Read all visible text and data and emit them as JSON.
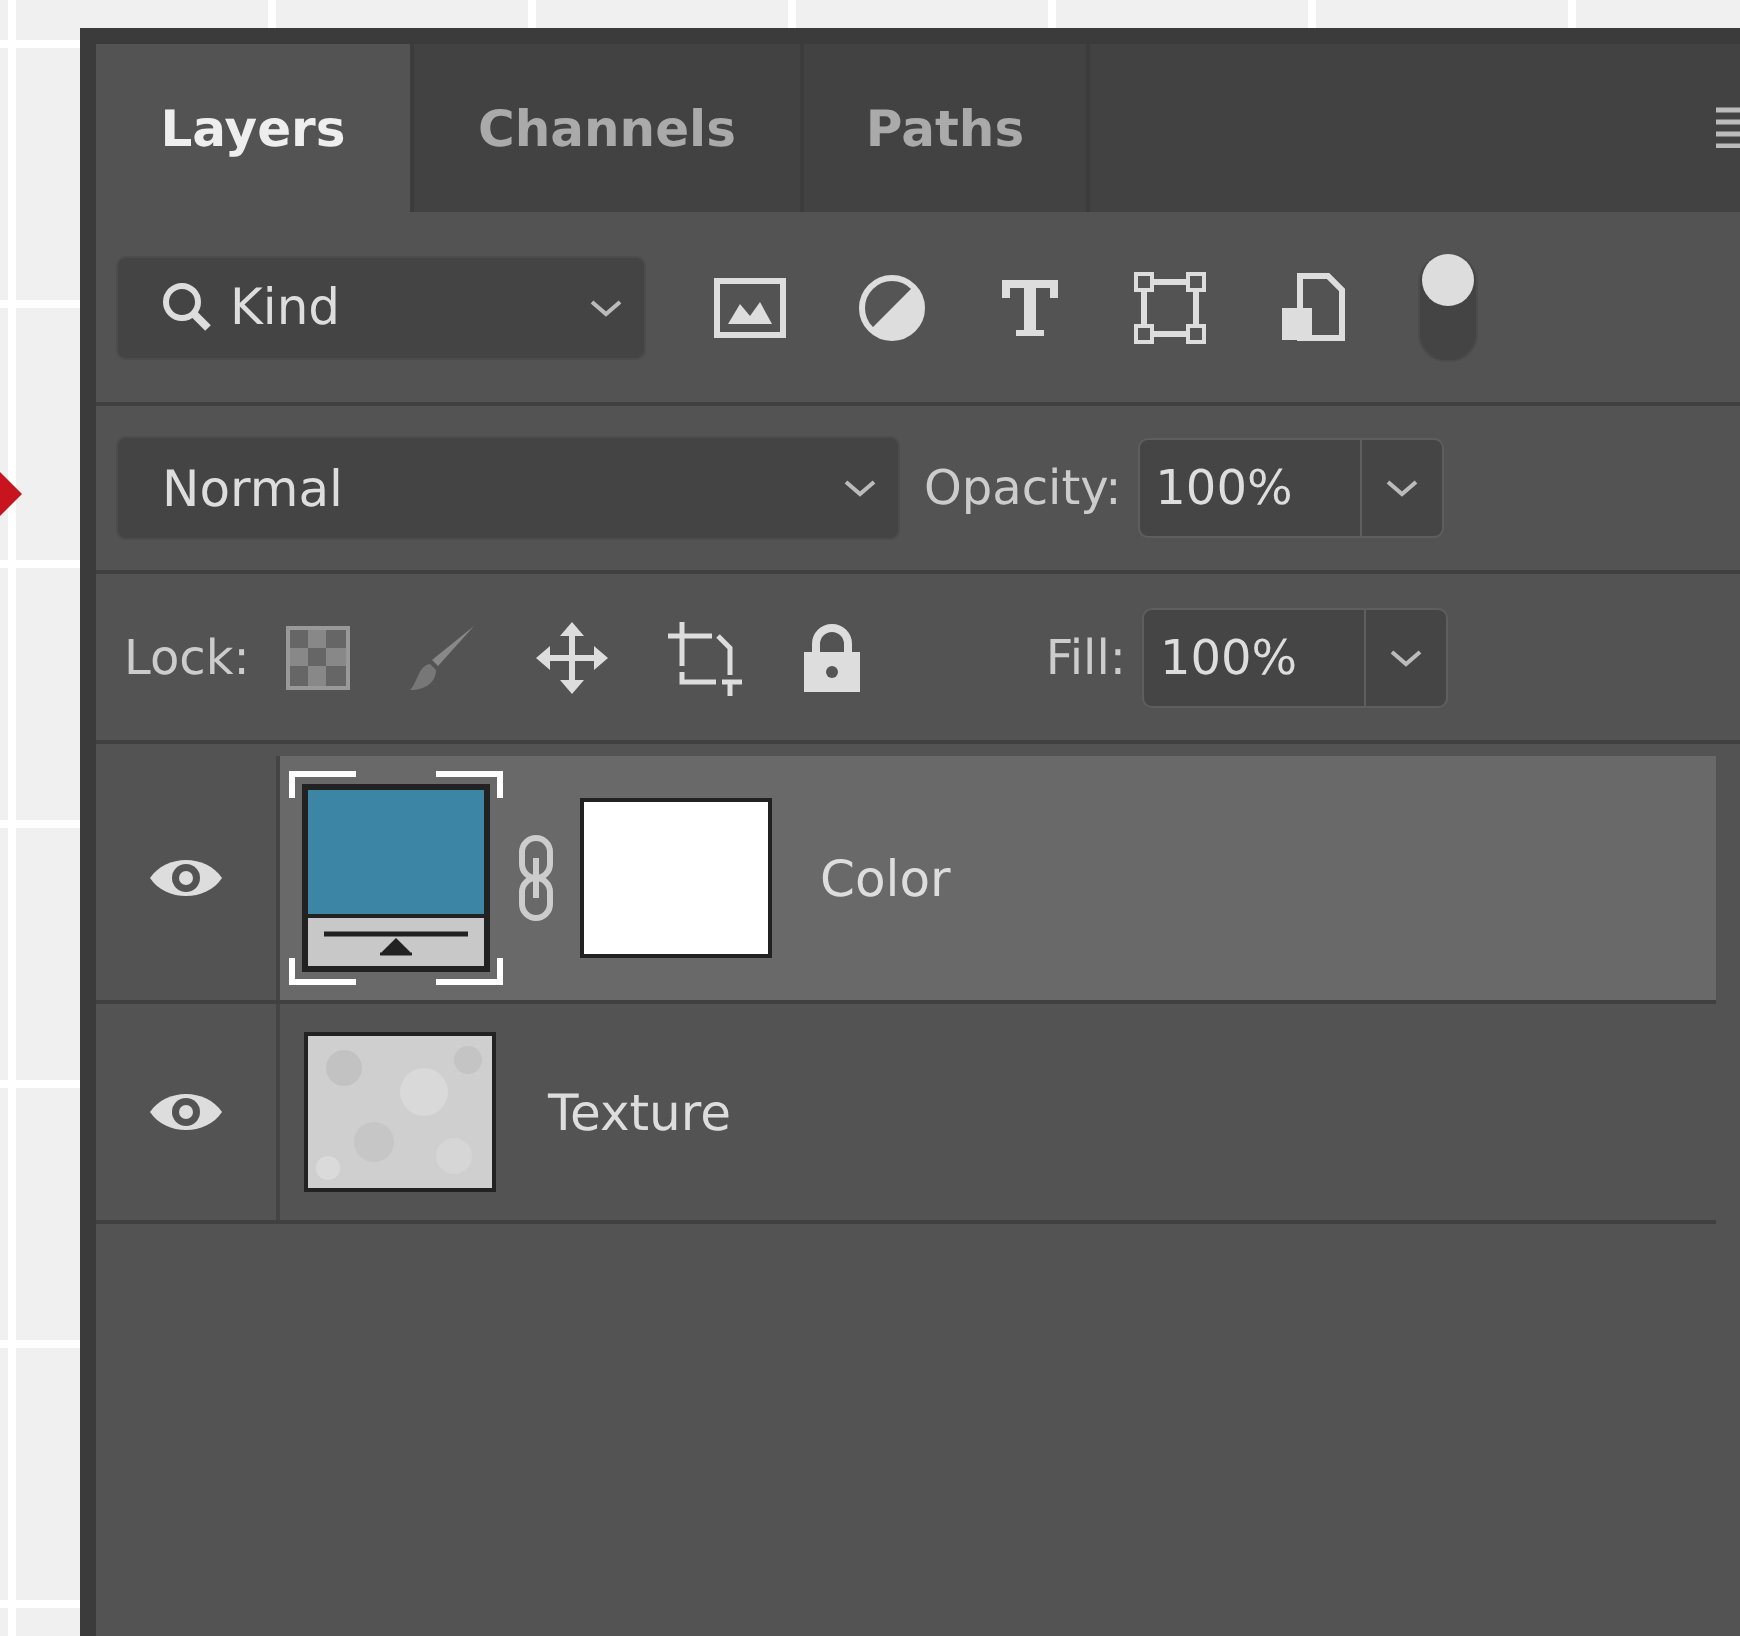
{
  "tabs": [
    {
      "label": "Layers",
      "selected": true
    },
    {
      "label": "Channels",
      "selected": false
    },
    {
      "label": "Paths",
      "selected": false
    }
  ],
  "filter": {
    "value": "Kind",
    "on": true
  },
  "blend_mode": {
    "value": "Normal"
  },
  "opacity": {
    "label": "Opacity:",
    "value": "100%"
  },
  "lock": {
    "label": "Lock:"
  },
  "fill": {
    "label": "Fill:",
    "value": "100%"
  },
  "layers": [
    {
      "name": "Color",
      "kind": "adjustment",
      "selected": true,
      "visible": true,
      "has_mask": true
    },
    {
      "name": "Texture",
      "kind": "pixel",
      "selected": false,
      "visible": true,
      "has_mask": false
    }
  ]
}
